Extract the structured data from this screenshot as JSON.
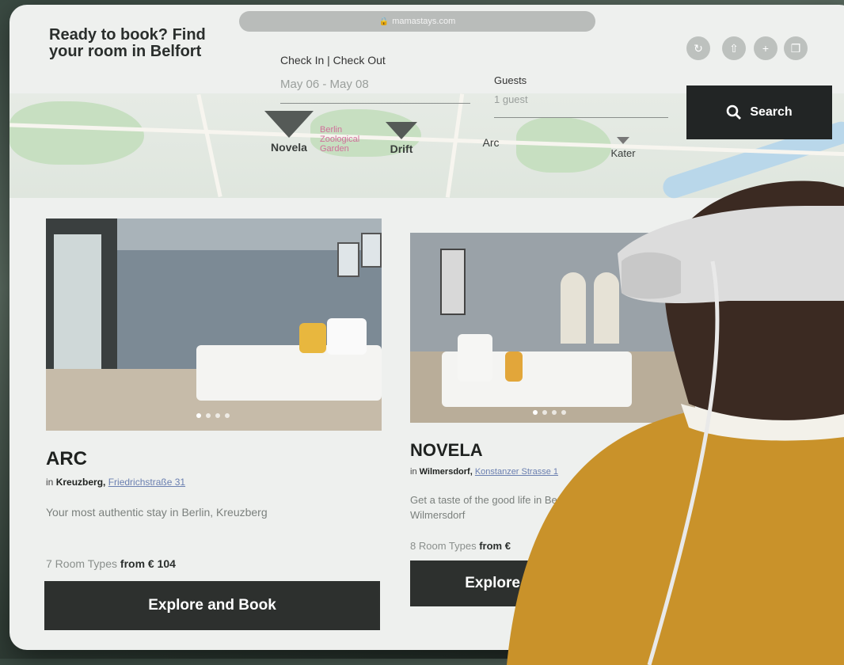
{
  "browser": {
    "url": "mamastays.com",
    "toolbar_icons": [
      "reload-icon",
      "share-icon",
      "new-tab-icon",
      "tabs-icon"
    ],
    "toolbar_glyphs": [
      "↻",
      "⇧",
      "+",
      "❐"
    ]
  },
  "hero": {
    "headline": "Ready to book? Find your room in Belfort"
  },
  "search": {
    "checkin_label": "Check In | Check Out",
    "checkin_value": "May 06 - May 08",
    "guests_label": "Guests",
    "guests_value": "1 guest",
    "button_label": "Search"
  },
  "map": {
    "pins": [
      "Novela",
      "Drift",
      "Arc",
      "Kater"
    ],
    "garden_label": "Berlin Zoological Garden"
  },
  "hotels": [
    {
      "name": "ARC",
      "district_prefix": "in",
      "district": "Kreuzberg,",
      "street": "Friedrichstraße 31",
      "description": "Your most authentic stay in Berlin, Kreuzberg",
      "types_text": "7 Room Types",
      "price_text": "from € 104",
      "button_label": "Explore and Book"
    },
    {
      "name": "NOVELA",
      "district_prefix": "in",
      "district": "Wilmersdorf,",
      "street": "Konstanzer Strasse 1",
      "description": "Get a taste of the good life in Berlin Wilmersdorf",
      "types_text": "8 Room Types",
      "price_text": "from €",
      "button_label": "Explore and Book"
    }
  ],
  "colors": {
    "accent_dark": "#222525",
    "map_park": "#c7dfc1",
    "map_water": "#b9d7ea",
    "sweater": "#c9922a"
  }
}
